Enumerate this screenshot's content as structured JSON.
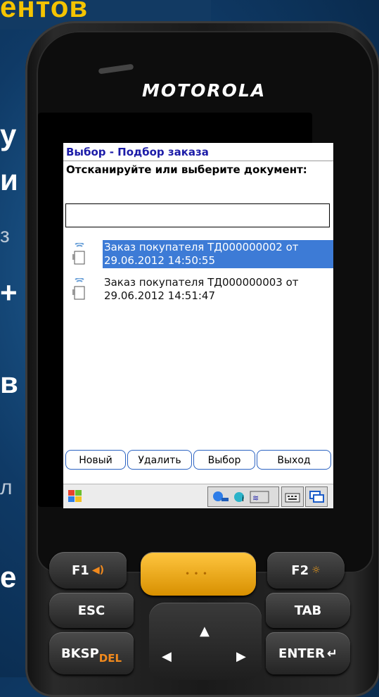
{
  "slide": {
    "title_fragment": "ентов",
    "bullet_fragments": [
      "у",
      "и",
      "з",
      "+",
      "в",
      "л",
      "е"
    ]
  },
  "device": {
    "brand": "MOTOROLA"
  },
  "app": {
    "window_title": "Выбор - Подбор заказа",
    "prompt": "Отсканируйте или выберите документ:",
    "scan_input": {
      "value": "",
      "placeholder": ""
    },
    "documents": [
      {
        "line1": "Заказ покупателя ТД000000002 от",
        "line2": "29.06.2012 14:50:55",
        "selected": true
      },
      {
        "line1": "Заказ покупателя ТД000000003 от",
        "line2": "29.06.2012 14:51:47",
        "selected": false
      }
    ],
    "buttons": {
      "new": "Новый",
      "delete": "Удалить",
      "select": "Выбор",
      "exit": "Выход"
    },
    "accent_color": "#3d7bd6",
    "title_color": "#1c1ca8"
  },
  "keypad": {
    "f1": "F1",
    "f2": "F2",
    "esc": "ESC",
    "tab": "TAB",
    "bksp": "BKSP",
    "del": "DEL",
    "enter": "ENTER",
    "enter_glyph": "↵"
  },
  "icons": {
    "start": "windows-flag-icon",
    "doc": "scanner-document-icon",
    "tray": [
      "network-icon",
      "connection-icon",
      "wifi-icon"
    ],
    "keyboard": "keyboard-icon",
    "windows_switch": "window-switch-icon",
    "f1_sound": "speaker-icon",
    "f2_brightness": "sun-icon"
  }
}
